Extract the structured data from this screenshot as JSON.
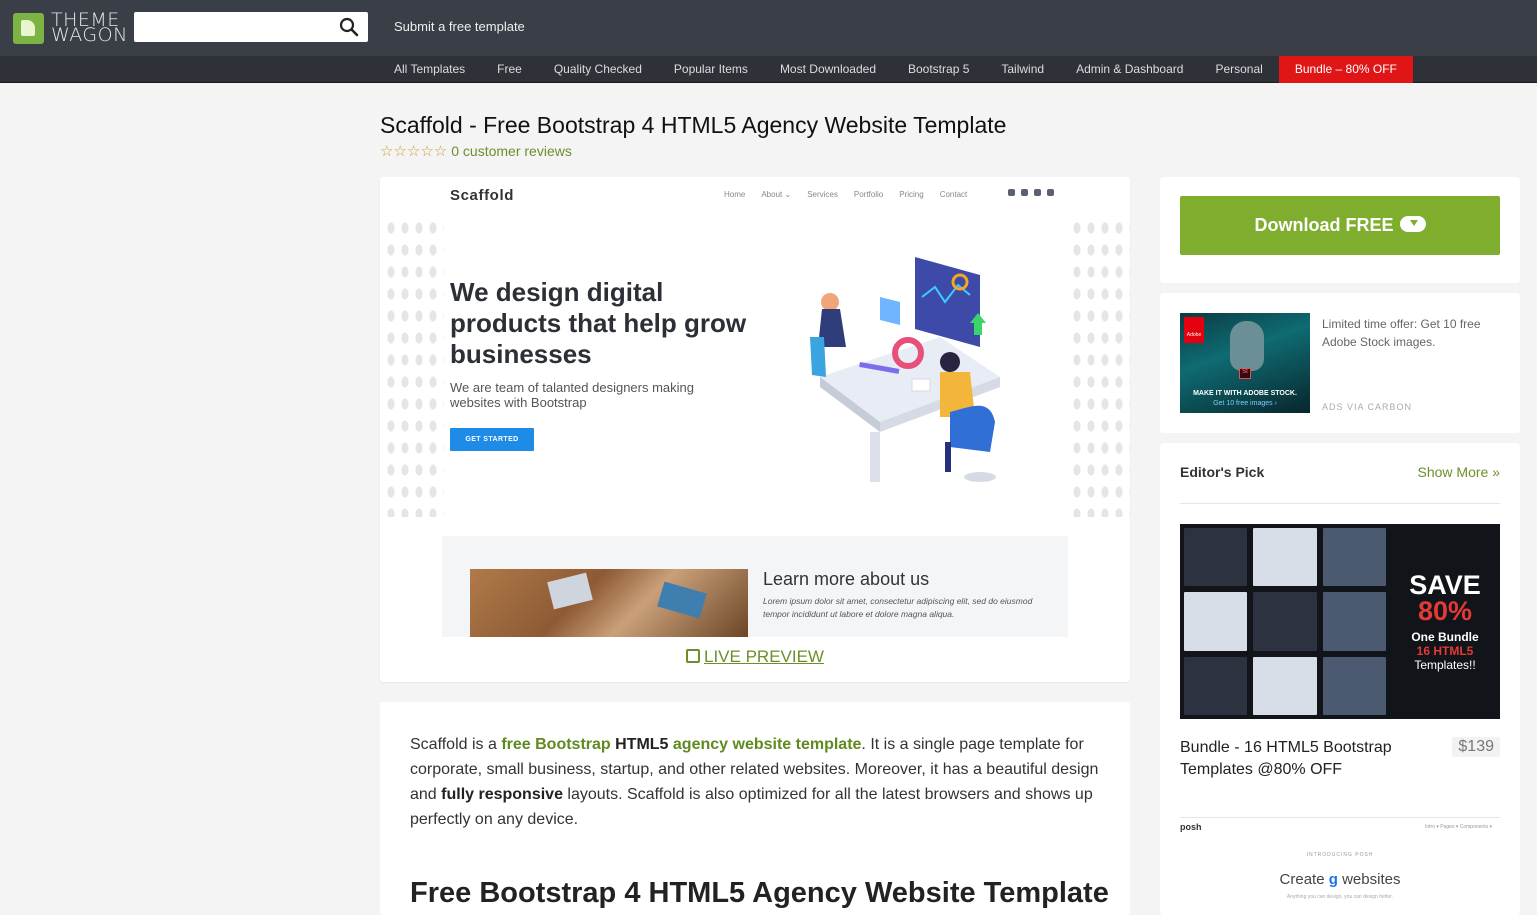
{
  "header": {
    "logo_text_line1": "THEME",
    "logo_text_line2": "WAGON",
    "search_placeholder": "",
    "submit_link": "Submit a free template"
  },
  "nav": {
    "items": [
      "All Templates",
      "Free",
      "Quality Checked",
      "Popular Items",
      "Most Downloaded",
      "Bootstrap 5",
      "Tailwind",
      "Admin & Dashboard",
      "Personal"
    ],
    "bundle": "Bundle – 80% OFF",
    "bundle_color": "#e01616"
  },
  "product": {
    "title": "Scaffold - Free Bootstrap 4 HTML5 Agency Website Template",
    "stars": "☆☆☆☆☆",
    "reviews": "0 customer reviews",
    "live_preview": "LIVE PREVIEW"
  },
  "screenshot": {
    "brand": "Scaffold",
    "nav": [
      "Home",
      "About ⌄",
      "Services",
      "Portfolio",
      "Pricing",
      "Contact"
    ],
    "headline": "We design digital products that help grow businesses",
    "sub": "We are team of talanted designers making websites with Bootstrap",
    "cta": "GET STARTED",
    "learn": "Learn more about us",
    "lorem": "Lorem ipsum dolor sit amet, consectetur adipiscing elit, sed do eiusmod tempor incididunt ut labore et dolore magna aliqua."
  },
  "description": {
    "p1_a": "Scaffold is a ",
    "p1_b": "free Bootstrap",
    "p1_c": " ",
    "p1_d": "HTML5",
    "p1_e": " ",
    "p1_f": "agency website template",
    "p1_g": ". It is a single page template for corporate, small business, startup, and other related websites. Moreover, it has a beautiful design and ",
    "p1_h": "fully responsive",
    "p1_i": " layouts. Scaffold is also optimized for all the latest browsers and shows up perfectly on any device.",
    "h2": "Free Bootstrap 4 HTML5 Agency Website Template"
  },
  "sidebar": {
    "download": "Download FREE",
    "download_color": "#7fae2e",
    "ad": {
      "text": "Limited time offer: Get 10 free Adobe Stock images.",
      "via": "ADS VIA CARBON",
      "img_line1": "MAKE IT WITH ADOBE STOCK.",
      "img_line2": "Get 10 free images ›",
      "adobe": "Adobe",
      "st": "St"
    },
    "editors_pick": {
      "title": "Editor's Pick",
      "show_more": "Show More »",
      "save_line1": "SAVE",
      "save_line2": "80%",
      "one_bundle": "One Bundle",
      "html_count": "16 HTML5",
      "templates": "Templates!!",
      "item_name": "Bundle - 16 HTML5 Bootstrap Templates @80% OFF",
      "item_price": "$139",
      "posh_brand": "posh",
      "posh_nav": "Intro ▾   Pages ▾   Components ▾",
      "posh_intro": "INTRODUCING POSH",
      "posh_create_a": "Create ",
      "posh_create_b": "g",
      "posh_create_c": " websites",
      "posh_tag": "Anything you can design, you can design better."
    }
  }
}
